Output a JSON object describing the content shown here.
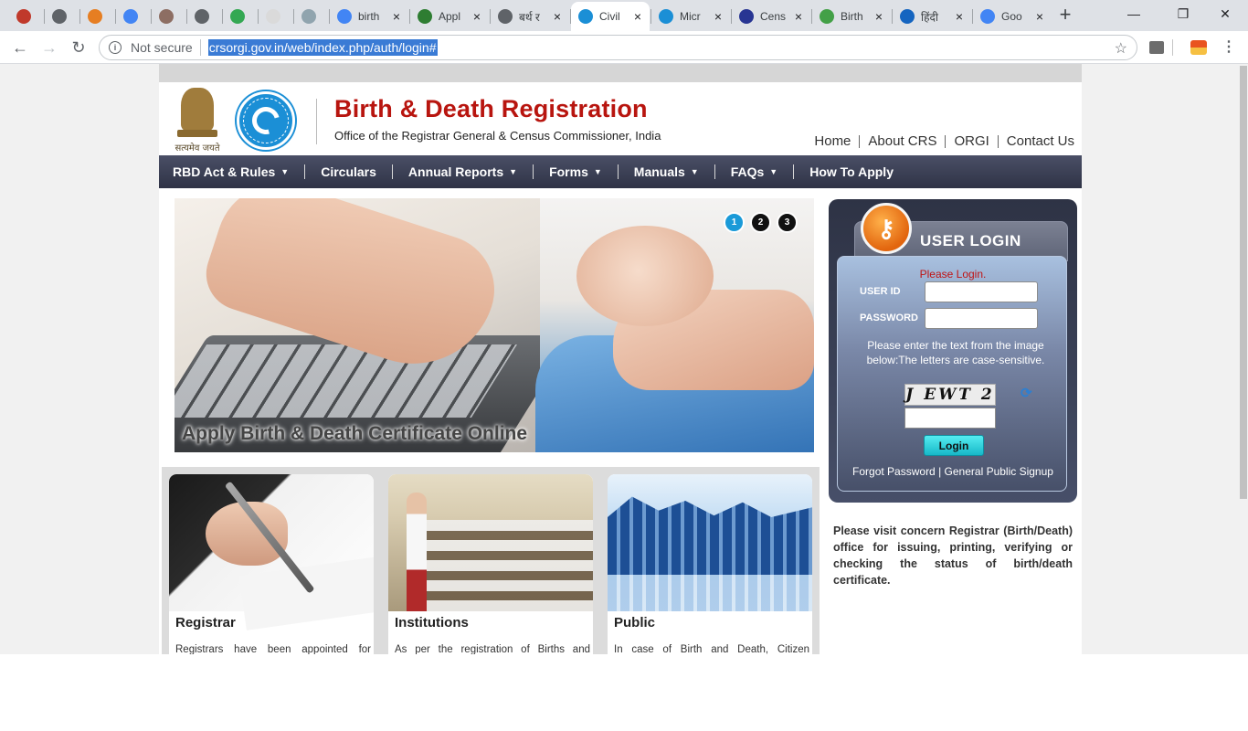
{
  "browser": {
    "tabs": [
      {
        "title": "",
        "favicon_color": "#c0392b",
        "active": false
      },
      {
        "title": "",
        "favicon_color": "#5f6368",
        "active": false
      },
      {
        "title": "",
        "favicon_color": "#e67e22",
        "active": false
      },
      {
        "title": "",
        "favicon_color": "#4285f4",
        "active": false
      },
      {
        "title": "",
        "favicon_color": "#8d6e63",
        "active": false
      },
      {
        "title": "",
        "favicon_color": "#5f6368",
        "active": false
      },
      {
        "title": "",
        "favicon_color": "#34a853",
        "active": false
      },
      {
        "title": "",
        "favicon_color": "#dadada",
        "active": false
      },
      {
        "title": "",
        "favicon_color": "#90a4ae",
        "active": false
      },
      {
        "title": "birth",
        "favicon_color": "#4285f4",
        "active": false
      },
      {
        "title": "Appl",
        "favicon_color": "#2e7d32",
        "active": false
      },
      {
        "title": "बर्थ र",
        "favicon_color": "#5f6368",
        "active": false
      },
      {
        "title": "Civil",
        "favicon_color": "#1b8fd6",
        "active": true
      },
      {
        "title": "Micr",
        "favicon_color": "#1b8fd6",
        "active": false
      },
      {
        "title": "Cens",
        "favicon_color": "#283593",
        "active": false
      },
      {
        "title": "Birth",
        "favicon_color": "#43a047",
        "active": false
      },
      {
        "title": "हिंदी",
        "favicon_color": "#1565c0",
        "active": false
      },
      {
        "title": "Goo",
        "favicon_color": "#4285f4",
        "active": false
      }
    ],
    "new_tab": "+",
    "window_controls": {
      "minimize": "—",
      "restore": "❐",
      "close": "✕"
    },
    "nav": {
      "back": "←",
      "forward": "→",
      "reload": "↻"
    },
    "security_label": "Not secure",
    "url": "crsorgi.gov.in/web/index.php/auth/login#",
    "bookmark_icon": "☆",
    "menu_icon": "⋮"
  },
  "header": {
    "emblem_motto": "सत्यमेव जयते",
    "title": "Birth & Death Registration",
    "subtitle": "Office of the Registrar General & Census Commissioner, India",
    "top_links": [
      "Home",
      "About CRS",
      "ORGI",
      "Contact Us"
    ]
  },
  "menu": [
    {
      "label": "RBD Act & Rules",
      "dropdown": true
    },
    {
      "label": "Circulars",
      "dropdown": false
    },
    {
      "label": "Annual Reports",
      "dropdown": true
    },
    {
      "label": "Forms",
      "dropdown": true
    },
    {
      "label": "Manuals",
      "dropdown": true
    },
    {
      "label": "FAQs",
      "dropdown": true
    },
    {
      "label": "How To Apply",
      "dropdown": false
    }
  ],
  "slider": {
    "caption": "Apply Birth & Death Certificate Online",
    "pages": [
      "1",
      "2",
      "3"
    ],
    "active_page": 1
  },
  "cards": [
    {
      "title": "Registrar",
      "text": "Registrars have been appointed for"
    },
    {
      "title": "Institutions",
      "text": "As per the registration of Births and"
    },
    {
      "title": "Public",
      "text": "In case of Birth and Death, Citizen"
    }
  ],
  "login": {
    "title": "USER LOGIN",
    "message": "Please Login.",
    "user_id_label": "USER ID",
    "password_label": "PASSWORD",
    "captcha_hint": "Please enter the text from the image below:The letters are case-sensitive.",
    "captcha_text": "J EWT 2",
    "button": "Login",
    "forgot_password": "Forgot Password",
    "link_separator": "|",
    "signup": "General Public Signup"
  },
  "notice": "Please visit concern Registrar (Birth/Death) office for issuing, printing, verifying or checking the status of birth/death certificate.",
  "colors": {
    "brand_red": "#b8150f",
    "menu_bar": "#2f3346",
    "accent_blue": "#1a9ad8",
    "login_button": "#17b8c8"
  }
}
